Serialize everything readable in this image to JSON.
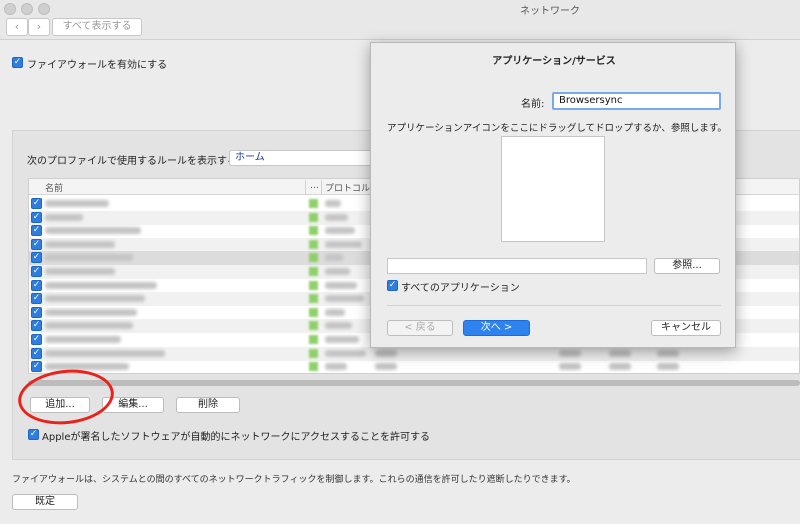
{
  "window": {
    "title": "ネットワーク",
    "back_label": "‹",
    "forward_label": "›",
    "show_all_label": "すべて表示する"
  },
  "firewall": {
    "enable_label": "ファイアウォールを有効にする",
    "enabled": true,
    "profile_prompt": "次のプロファイルで使用するルールを表示する:",
    "profile_value": "ホーム",
    "table": {
      "columns": [
        "名前",
        "…",
        "プロトコル"
      ],
      "row_count": 13,
      "rows_note_blurred": true
    },
    "add_label": "追加...",
    "edit_label": "編集...",
    "delete_label": "削除",
    "allow_signed_label": "Appleが署名したソフトウェアが自動的にネットワークにアクセスすることを許可する",
    "allow_signed": true,
    "footer_note": "ファイアウォールは、システムとの間のすべてのネットワークトラフィックを制御します。これらの通信を許可したり遮断したりできます。",
    "defaults_label": "既定"
  },
  "dialog": {
    "title": "アプリケーション/サービス",
    "name_label": "名前:",
    "name_value": "Browsersync",
    "drag_hint": "アプリケーションアイコンをここにドラッグしてドロップするか、参照します。",
    "path_value": "",
    "browse_label": "参照...",
    "all_apps_label": "すべてのアプリケーション",
    "all_apps": true,
    "back_label": "< 戻る",
    "next_label": "次へ >",
    "cancel_label": "キャンセル"
  },
  "colors": {
    "accent": "#2f83ee",
    "annotation": "#e8231d"
  }
}
